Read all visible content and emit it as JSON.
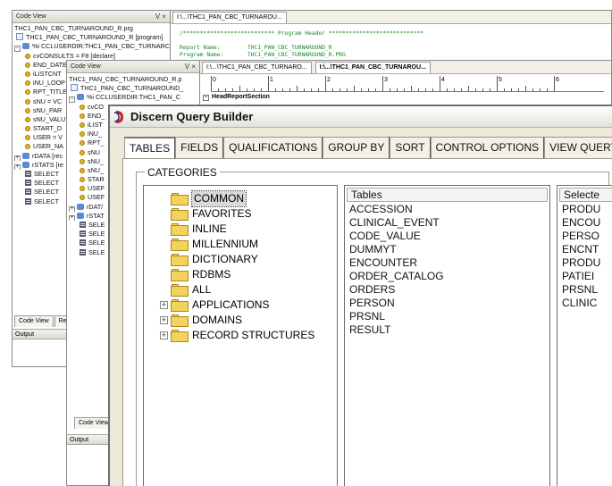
{
  "window1": {
    "title": "Code View",
    "title_controls": "V ×",
    "tree": [
      {
        "text": "THC1_PAN_CBC_TURNAROUND_R.prg",
        "icon": "none"
      },
      {
        "text": "THC1_PAN_CBC_TURNAROUND_R [program]",
        "icon": "doc"
      },
      {
        "text": "%i CCLUSERDIR:THC1_PAN_CBC_TURNARC",
        "icon": "net",
        "pm": "−"
      },
      {
        "text": "cvCONSULTS = F8 [declare]",
        "icon": "dot"
      },
      {
        "text": "END_DATE",
        "icon": "dot"
      },
      {
        "text": "iLISTCNT",
        "icon": "dot"
      },
      {
        "text": "iNU_LOOP",
        "icon": "dot"
      },
      {
        "text": "RPT_TITLE",
        "icon": "dot"
      },
      {
        "text": "sNU = VC",
        "icon": "dot"
      },
      {
        "text": "sNU_PAR",
        "icon": "dot"
      },
      {
        "text": "sNU_VALU",
        "icon": "dot"
      },
      {
        "text": "START_D",
        "icon": "dot"
      },
      {
        "text": "USER = V",
        "icon": "dot"
      },
      {
        "text": "USER_NA",
        "icon": "dot"
      },
      {
        "text": "rDATA [rec",
        "icon": "net",
        "pm": "+"
      },
      {
        "text": "rSTATS [re",
        "icon": "net",
        "pm": "+"
      },
      {
        "text": "SELECT",
        "icon": "tbl"
      },
      {
        "text": "SELECT",
        "icon": "tbl"
      },
      {
        "text": "SELECT",
        "icon": "tbl"
      },
      {
        "text": "SELECT",
        "icon": "tbl"
      }
    ],
    "tabs": [
      "Code View",
      "Re"
    ],
    "output_label": "Output"
  },
  "editor1": {
    "tab_label": "I:\\...\\THC1_PAN_CBC_TURNAROU...",
    "code_lines": [
      "/*************************** Program Header ****************************",
      "",
      "Report Name:        THC1_PAN_CBC_TURNAROUND_R",
      "Program Name:       THC1_PAN_CBC_TURNAROUND_R.PRG"
    ]
  },
  "window2": {
    "title": "Code View",
    "title_controls": "V ×",
    "tree": [
      {
        "text": "THC1_PAN_CBC_TURNAROUND_R.p",
        "icon": "none"
      },
      {
        "text": "THC1_PAN_CBC_TURNAROUND_",
        "icon": "doc"
      },
      {
        "text": "%i CCLUSERDIR:THC1_PAN_C",
        "icon": "net",
        "pm": "−"
      },
      {
        "text": "cvCO",
        "icon": "dot"
      },
      {
        "text": "END_",
        "icon": "dot"
      },
      {
        "text": "iLIST",
        "icon": "dot"
      },
      {
        "text": "iNU_",
        "icon": "dot"
      },
      {
        "text": "RPT_",
        "icon": "dot"
      },
      {
        "text": "sNU",
        "icon": "dot"
      },
      {
        "text": "sNU_",
        "icon": "dot"
      },
      {
        "text": "sNU_",
        "icon": "dot"
      },
      {
        "text": "STAR",
        "icon": "dot"
      },
      {
        "text": "USEF",
        "icon": "dot"
      },
      {
        "text": "USEF",
        "icon": "dot"
      },
      {
        "text": "rDAT/",
        "icon": "net",
        "pm": "+"
      },
      {
        "text": "rSTAT",
        "icon": "net",
        "pm": "+"
      },
      {
        "text": "SELE",
        "icon": "tbl"
      },
      {
        "text": "SELE",
        "icon": "tbl"
      },
      {
        "text": "SELE",
        "icon": "tbl"
      },
      {
        "text": "SELE",
        "icon": "tbl"
      }
    ],
    "tabs": [
      "Code View"
    ],
    "output_label": "Output"
  },
  "editor2": {
    "tabs": [
      "I:\\...\\THC1_PAN_CBC_TURNARO...",
      "I:\\...\\THC1_PAN_CBC_TURNAROU..."
    ],
    "ruler_numbers": [
      "0",
      "1",
      "2",
      "3",
      "4",
      "5",
      "6"
    ],
    "section_label": "HeadReportSection"
  },
  "query_builder": {
    "title": "Discern Query Builder",
    "tabs": [
      "TABLES",
      "FIELDS",
      "QUALIFICATIONS",
      "GROUP BY",
      "SORT",
      "CONTROL OPTIONS",
      "VIEW QUERY"
    ],
    "categories_legend": "CATEGORIES",
    "categories": [
      {
        "label": "COMMON",
        "expander": "",
        "selected": true
      },
      {
        "label": "FAVORITES",
        "expander": ""
      },
      {
        "label": "INLINE",
        "expander": ""
      },
      {
        "label": "MILLENNIUM",
        "expander": ""
      },
      {
        "label": "DICTIONARY",
        "expander": ""
      },
      {
        "label": "RDBMS",
        "expander": ""
      },
      {
        "label": "ALL",
        "expander": ""
      },
      {
        "label": "APPLICATIONS",
        "expander": "+"
      },
      {
        "label": "DOMAINS",
        "expander": "+"
      },
      {
        "label": "RECORD STRUCTURES",
        "expander": "+"
      }
    ],
    "tables_header": "Tables",
    "tables": [
      "ACCESSION",
      "CLINICAL_EVENT",
      "CODE_VALUE",
      "DUMMYT",
      "ENCOUNTER",
      "ORDER_CATALOG",
      "ORDERS",
      "PERSON",
      "PRSNL",
      "RESULT"
    ],
    "selected_header": "Selecte",
    "selected": [
      "PRODU",
      "ENCOU",
      "PERSO",
      "ENCNT",
      "PRODU",
      "PATIEI",
      "PRSNL",
      "CLINIC"
    ],
    "colors": {
      "folder": "#f5d35a",
      "dialog_bg": "#ece9d8",
      "code_green": "#1a8a2a"
    }
  }
}
